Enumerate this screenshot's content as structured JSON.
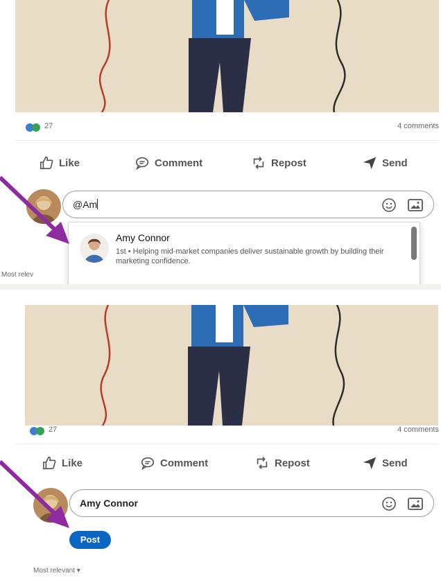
{
  "top_panel": {
    "reactions_count": "27",
    "comments_count": "4 comments",
    "actions": {
      "like": "Like",
      "comment": "Comment",
      "repost": "Repost",
      "send": "Send"
    },
    "input_value": "@Am",
    "mention_suggestion": {
      "name": "Amy Connor",
      "description": "1st • Helping mid-market companies deliver sustainable growth by building their marketing confidence."
    },
    "sort_label": "Most relev"
  },
  "bottom_panel": {
    "reactions_count": "27",
    "comments_count": "4 comments",
    "actions": {
      "like": "Like",
      "comment": "Comment",
      "repost": "Repost",
      "send": "Send"
    },
    "input_value": "Amy Connor",
    "post_button": "Post",
    "sort_label": "Most relevant ▾"
  },
  "colors": {
    "hero_bg": "#e9dcc7",
    "jacket": "#2c6db5",
    "trousers": "#2a2f45",
    "arrow": "#8e2ba0",
    "post_button": "#0a66c2"
  },
  "icons": [
    "like-icon",
    "comment-icon",
    "repost-icon",
    "send-icon",
    "emoji-icon",
    "image-icon",
    "arrow-annotation"
  ]
}
